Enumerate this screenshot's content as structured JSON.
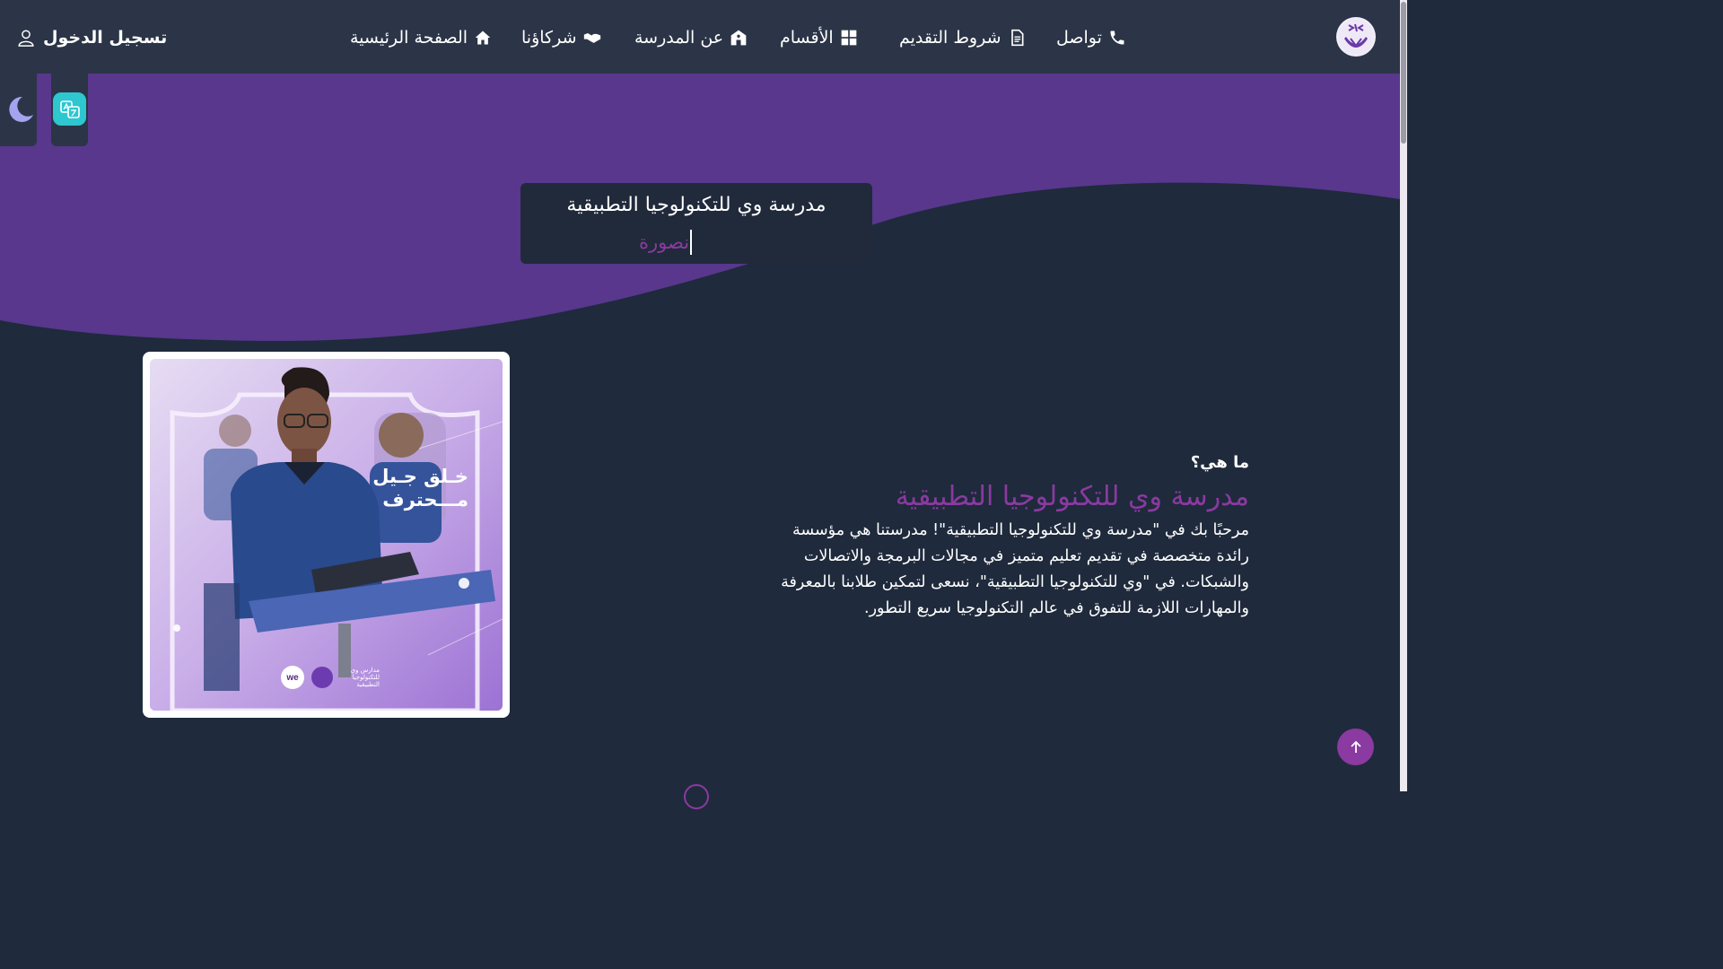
{
  "nav": {
    "login": "تسجيل الدخول",
    "items": [
      {
        "label": "الصفحة الرئيسية",
        "icon": "home-icon"
      },
      {
        "label": "شركاؤنا",
        "icon": "handshake-icon"
      },
      {
        "label": "عن المدرسة",
        "icon": "school-icon"
      },
      {
        "label": "الأقسام",
        "icon": "grid-icon"
      },
      {
        "label": "شروط التقديم",
        "icon": "document-icon"
      },
      {
        "label": "تواصل",
        "icon": "phone-icon"
      }
    ]
  },
  "hero": {
    "title": "مدرسة وي للتكنولوجيا التطبيقية",
    "typed_text": "نصورة"
  },
  "image_card": {
    "caption_line1": "خـلق جـيل",
    "caption_line2": "مـــحترف",
    "logo_badge": "we",
    "logo_text": "مدارس وي للتكنولوجيا التطبيقية"
  },
  "about": {
    "question": "ما هي؟",
    "heading": "مدرسة وي للتكنولوجيا التطبيقية",
    "paragraph": "مرحبًا بك في \"مدرسة وي للتكنولوجيا التطبيقية\"! مدرستنا هي مؤسسة رائدة متخصصة في تقديم تعليم متميز في مجالات البرمجة والاتصالات والشبكات. في \"وي للتكنولوجيا التطبيقية\"، نسعى لتمكين طلابنا بالمعرفة والمهارات اللازمة للتفوق في عالم التكنولوجيا سريع التطور."
  },
  "colors": {
    "background": "#1f2a3c",
    "navbar": "#2b3547",
    "hero_purple": "#58378c",
    "accent": "#8a3aa0",
    "translate_button": "#2ec6cf"
  }
}
